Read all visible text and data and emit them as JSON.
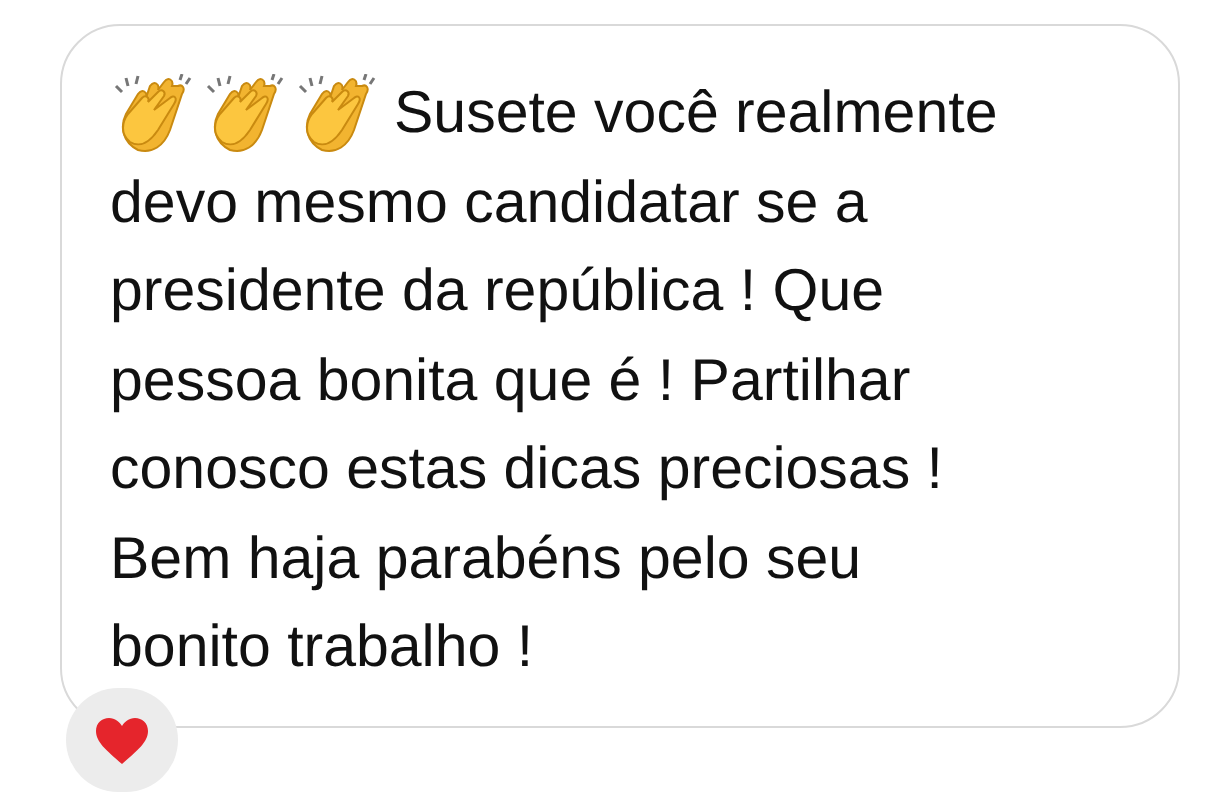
{
  "message": {
    "lines": [
      "Susete você realmente",
      "devo mesmo candidatar se a",
      "presidente da república ! Que",
      "pessoa bonita que é ! Partilhar",
      "conosco estas dicas preciosas !",
      "Bem haja parabéns pelo seu",
      "bonito trabalho !"
    ],
    "reactions": [
      {
        "kind": "heart"
      }
    ]
  }
}
